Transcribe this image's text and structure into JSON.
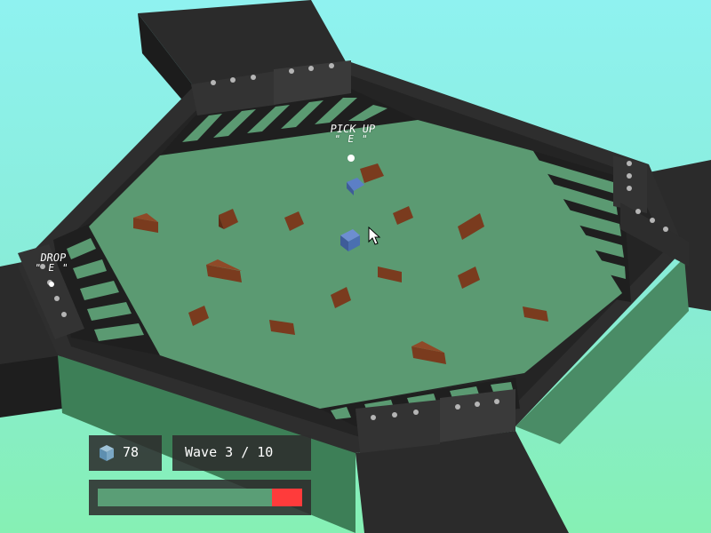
{
  "world_labels": {
    "pickup": {
      "line1": "PICK UP",
      "line2": "\" E \""
    },
    "drop": {
      "line1": "DROP",
      "line2": "\" E \""
    }
  },
  "hud": {
    "coins": "78",
    "wave": "Wave 3 / 10",
    "health_fraction": 0.85,
    "health_color": "#ff3b3b",
    "health_track_color": "#5a9e76"
  },
  "icons": {
    "coin": "blue-cube-icon",
    "cursor": "mouse-pointer-icon"
  },
  "colors": {
    "sky": "#8ff2f0",
    "floor": "#5b9a72",
    "wall": "#2a2a2a",
    "crate": "#7a3b1e",
    "player": "#4a6fb0"
  }
}
